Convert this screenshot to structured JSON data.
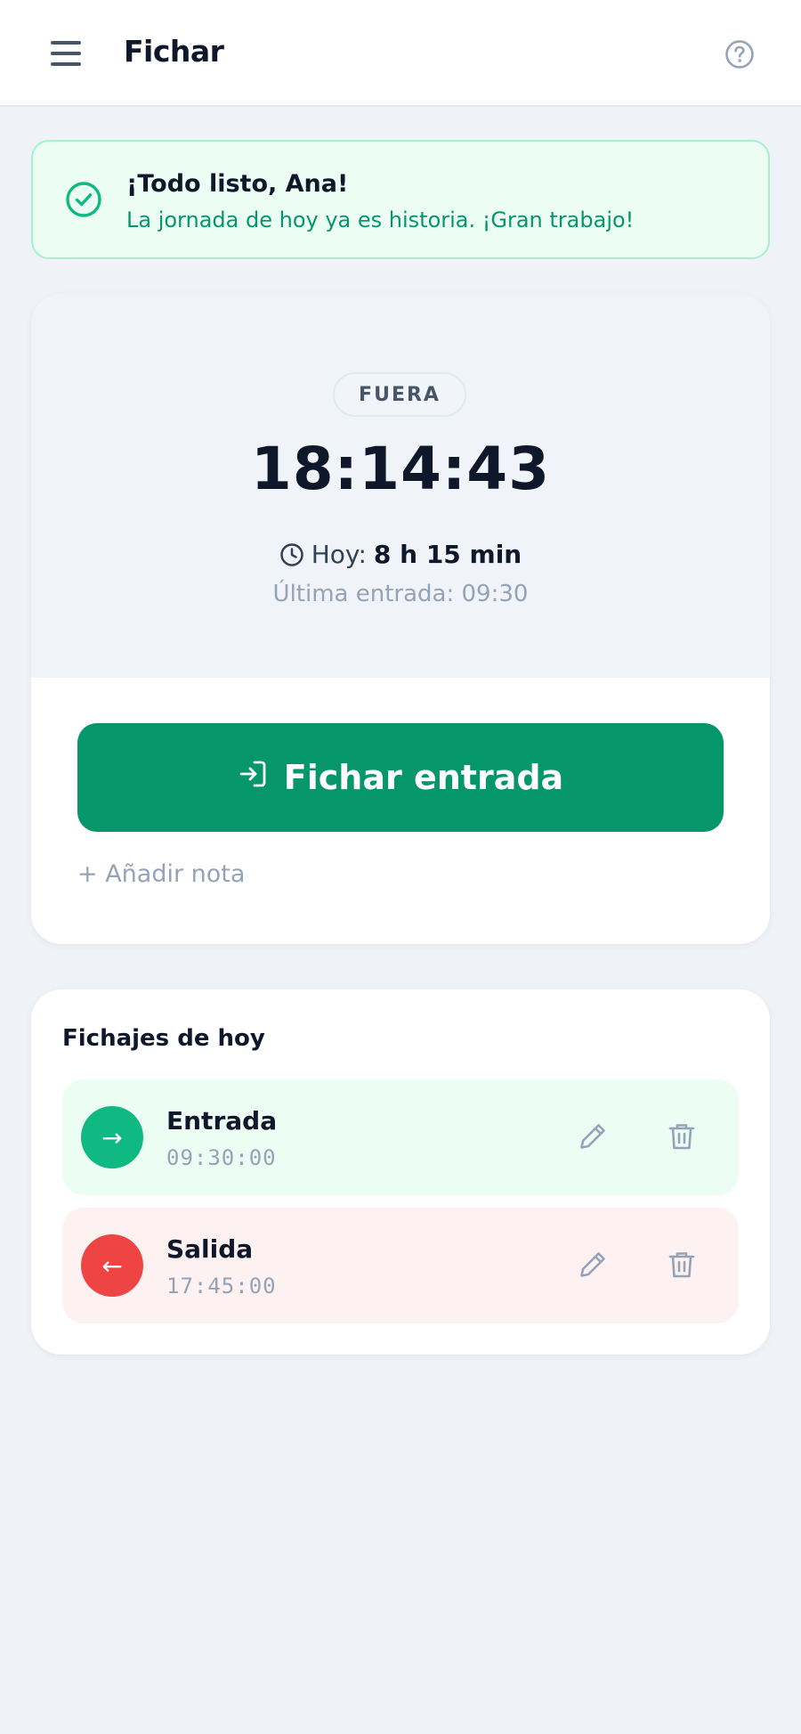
{
  "header": {
    "title": "Fichar"
  },
  "banner": {
    "title": "¡Todo listo, Ana!",
    "message": "La jornada de hoy ya es historia. ¡Gran trabajo!"
  },
  "clock_card": {
    "status": "FUERA",
    "time": "18:14:43",
    "today_label": "Hoy:",
    "today_value": "8 h 15 min",
    "last_entry": "Última entrada: 09:30",
    "action_label": "Fichar entrada",
    "add_note": "+ Añadir nota"
  },
  "records": {
    "title": "Fichajes de hoy",
    "items": [
      {
        "type": "Entrada",
        "time": "09:30:00",
        "arrow": "→"
      },
      {
        "type": "Salida",
        "time": "17:45:00",
        "arrow": "←"
      }
    ]
  },
  "colors": {
    "accent": "#059669",
    "entry": "#10b981",
    "exit": "#ef4444",
    "banner_bg": "#ecfdf4"
  },
  "icons": {
    "menu": "menu-icon",
    "help": "help-circle-icon",
    "success": "check-circle-icon",
    "clock": "clock-icon",
    "login": "login-icon",
    "edit": "pencil-icon",
    "delete": "trash-icon"
  }
}
